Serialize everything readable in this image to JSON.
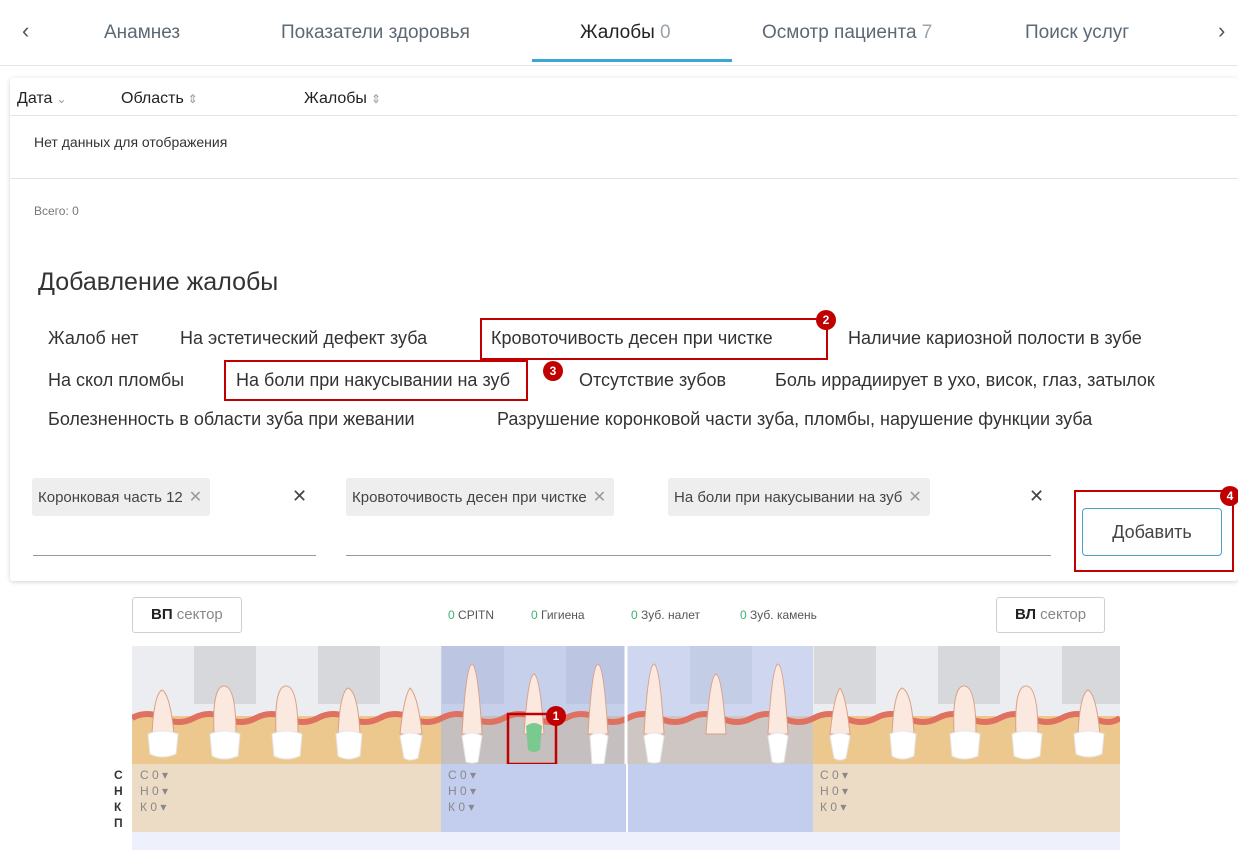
{
  "tabs": [
    {
      "label": "Анамнез",
      "count": ""
    },
    {
      "label": "Показатели здоровья",
      "count": ""
    },
    {
      "label": "Жалобы",
      "count": "0"
    },
    {
      "label": "Осмотр пациента",
      "count": "7"
    },
    {
      "label": "Поиск услуг",
      "count": ""
    }
  ],
  "table": {
    "columns": [
      "Дата",
      "Область",
      "Жалобы"
    ],
    "empty_text": "Нет данных для отображения",
    "total": "Всего: 0"
  },
  "add_complaint": {
    "title": "Добавление жалобы",
    "options": [
      "Жалоб нет",
      "На эстетический дефект зуба",
      "Кровоточивость десен при чистке",
      "Наличие кариозной полости в зубе",
      "На скол пломбы",
      "На боли при накусывании на зуб",
      "Отсутствие зубов",
      "Боль иррадиирует в ухо, висок, глаз, затылок",
      "Болезненность в области зуба при жевании",
      "Разрушение коронковой части зуба, пломбы, нарушение функции зуба"
    ],
    "selected_area": [
      "Коронковая часть 12"
    ],
    "selected_complaints": [
      "Кровоточивость десен при чистке",
      "На боли при накусывании на зуб"
    ],
    "add_label": "Добавить"
  },
  "callouts": [
    "1",
    "2",
    "3",
    "4"
  ],
  "tooth_chart": {
    "left_sector": {
      "bold": "ВП",
      "rest": " сектор"
    },
    "right_sector": {
      "bold": "ВЛ",
      "rest": " сектор"
    },
    "stats": [
      {
        "value": "0",
        "label": " CPITN"
      },
      {
        "value": "0",
        "label": " Гигиена"
      },
      {
        "value": "0",
        "label": " Зуб. налет"
      },
      {
        "value": "0",
        "label": " Зуб. камень"
      }
    ],
    "row_labels": [
      "С",
      "Н",
      "К",
      "П"
    ],
    "cell_values": [
      "С 0",
      "Н 0",
      "К 0"
    ],
    "colors": {
      "highlight": "#a8b8e8",
      "gum": "#e9c99a",
      "selected_tooth": "#7ac98e"
    }
  }
}
